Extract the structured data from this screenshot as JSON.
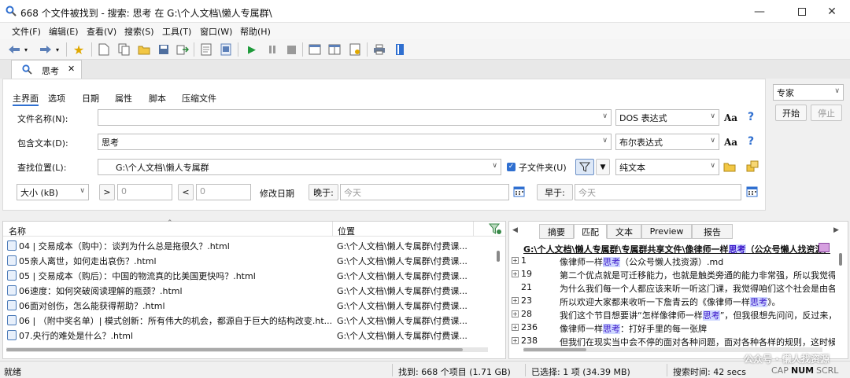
{
  "window": {
    "title": "668 个文件被找到 - 搜索: 思考 在 G:\\个人文档\\懒人专属群\\",
    "controls": [
      "minimize",
      "maximize",
      "close"
    ]
  },
  "menu": [
    "文件(F)",
    "编辑(E)",
    "查看(V)",
    "搜索(S)",
    "工具(T)",
    "窗口(W)",
    "帮助(H)"
  ],
  "doc_tab": {
    "label": "思考"
  },
  "search_tabs": [
    "主界面",
    "选项",
    "日期",
    "属性",
    "脚本",
    "压缩文件"
  ],
  "form": {
    "filename_label": "文件名称(N):",
    "filename_value": "",
    "filename_mode": "DOS 表达式",
    "content_label": "包含文本(D):",
    "content_value": "思考",
    "content_mode": "布尔表达式",
    "location_label": "查找位置(L):",
    "location_value": "G:\\个人文档\\懒人专属群",
    "subfolders_label": "子文件夹(U)",
    "subfolders_checked": true,
    "filetype_value": "纯文本",
    "case_icon_label": "Aa",
    "help_label": "?",
    "size_label": "大小 (kB)",
    "size_gt_label": ">",
    "size_gt_value": "0",
    "size_lt_label": "<",
    "size_lt_value": "0",
    "modified_label": "修改日期",
    "later_label": "晚于:",
    "later_value": "今天",
    "earlier_label": "早于:",
    "earlier_value": "今天"
  },
  "mode": {
    "selected": "专家",
    "start_label": "开始",
    "stop_label": "停止"
  },
  "results": {
    "col_name": "名称",
    "col_location": "位置",
    "rows": [
      {
        "name": "04 | 交易成本（购中）：谈判为什么总是拖很久？.html",
        "location": "G:\\个人文档\\懒人专属群\\付费课..."
      },
      {
        "name": "05亲人离世，如何走出哀伤？.html",
        "location": "G:\\个人文档\\懒人专属群\\付费课..."
      },
      {
        "name": "05 | 交易成本（购后）：中国的物流真的比美国更快吗？.html",
        "location": "G:\\个人文档\\懒人专属群\\付费课..."
      },
      {
        "name": "06速度：如何突破阅读理解的瓶颈？.html",
        "location": "G:\\个人文档\\懒人专属群\\付费课..."
      },
      {
        "name": "06面对创伤，怎么能获得帮助？.html",
        "location": "G:\\个人文档\\懒人专属群\\付费课..."
      },
      {
        "name": "06 | （附中奖名单）| 模式创新：所有伟大的机会，都源自于巨大的结构改变.ht...",
        "location": "G:\\个人文档\\懒人专属群\\付费课..."
      },
      {
        "name": "07.央行的难处是什么？.html",
        "location": "G:\\个人文档\\懒人专属群\\付费课..."
      }
    ]
  },
  "preview": {
    "tabs": [
      "摘要",
      "匹配",
      "文本",
      "Preview",
      "报告"
    ],
    "active_tab": "匹配",
    "header_prefix": "G:\\个人文档\\懒人专属群\\专属群共享文件\\像律师一样",
    "header_hl": "思考",
    "header_suffix": "（公众号懒人找资源）",
    "rows": [
      {
        "line": "1",
        "pre": "像律师一样",
        "hl": "思考",
        "post": "（公众号懒人找资源）.md",
        "expand": true
      },
      {
        "line": "19",
        "pre": "第二个优点就是可迁移能力，也就是触类旁通的能力非常强，所以我觉得她",
        "hl": "",
        "post": "",
        "expand": true
      },
      {
        "line": "21",
        "pre": "为什么我们每一个人都应该来听一听这门课，我觉得咱们这个社会是由各种",
        "hl": "",
        "post": "",
        "expand": false
      },
      {
        "line": "23",
        "pre": "所以欢迎大家都来收听一下詹青云的《像律师一样",
        "hl": "思考",
        "post": "》。",
        "expand": true
      },
      {
        "line": "28",
        "pre": "我们这个节目想要讲“怎样像律师一样",
        "hl": "思考",
        "post": "”，但我很想先问问，反过来，我",
        "expand": true
      },
      {
        "line": "236",
        "pre": "像律师一样",
        "hl": "思考",
        "post": "：打好手里的每一张牌",
        "expand": true
      },
      {
        "line": "238",
        "pre": "但我们在现实当中会不停的面对各种问题，面对各种各样的规则，这时候就",
        "hl": "",
        "post": "",
        "expand": true
      }
    ]
  },
  "status": {
    "ready": "就绪",
    "found": "找到: 668 个项目 (1.71 GB)",
    "selected": "已选择: 1 项 (34.39 MB)",
    "time": "搜索时间: 42 secs",
    "cap": "CAP",
    "num": "NUM",
    "scrl": "SCRL"
  },
  "watermark": "公众号 · 懒人找资源",
  "colors": {
    "accent": "#2f6fd0",
    "highlight": "#cfd8ff",
    "play": "#1e9a3a"
  }
}
